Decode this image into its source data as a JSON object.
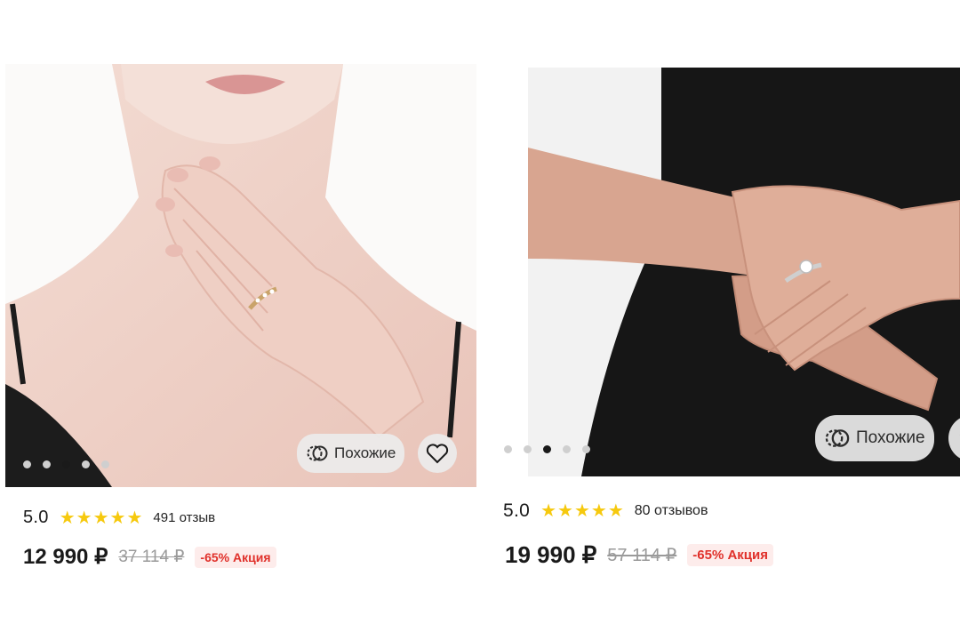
{
  "products": [
    {
      "image_alt": "Тонкое кольцо с камнями на руке",
      "carousel": {
        "total": 5,
        "active_index": 2
      },
      "similar_label": "Похожие",
      "rating": "5.0",
      "stars": 5,
      "reviews": "491 отзыв",
      "price": "12 990 ₽",
      "old_price": "37 114 ₽",
      "badge": "-65% Акция"
    },
    {
      "image_alt": "Кольцо с крупным камнем на руке",
      "carousel": {
        "total": 5,
        "active_index": 2
      },
      "similar_label": "Похожие",
      "rating": "5.0",
      "stars": 5,
      "reviews": "80 отзывов",
      "price": "19 990 ₽",
      "old_price": "57 114 ₽",
      "badge": "-65% Акция"
    }
  ],
  "colors": {
    "star": "#f6c90e",
    "badge_text": "#e0302a",
    "badge_bg": "#fdeceb"
  },
  "icons": {
    "similar": "similar-icon",
    "favorite": "heart-icon"
  }
}
